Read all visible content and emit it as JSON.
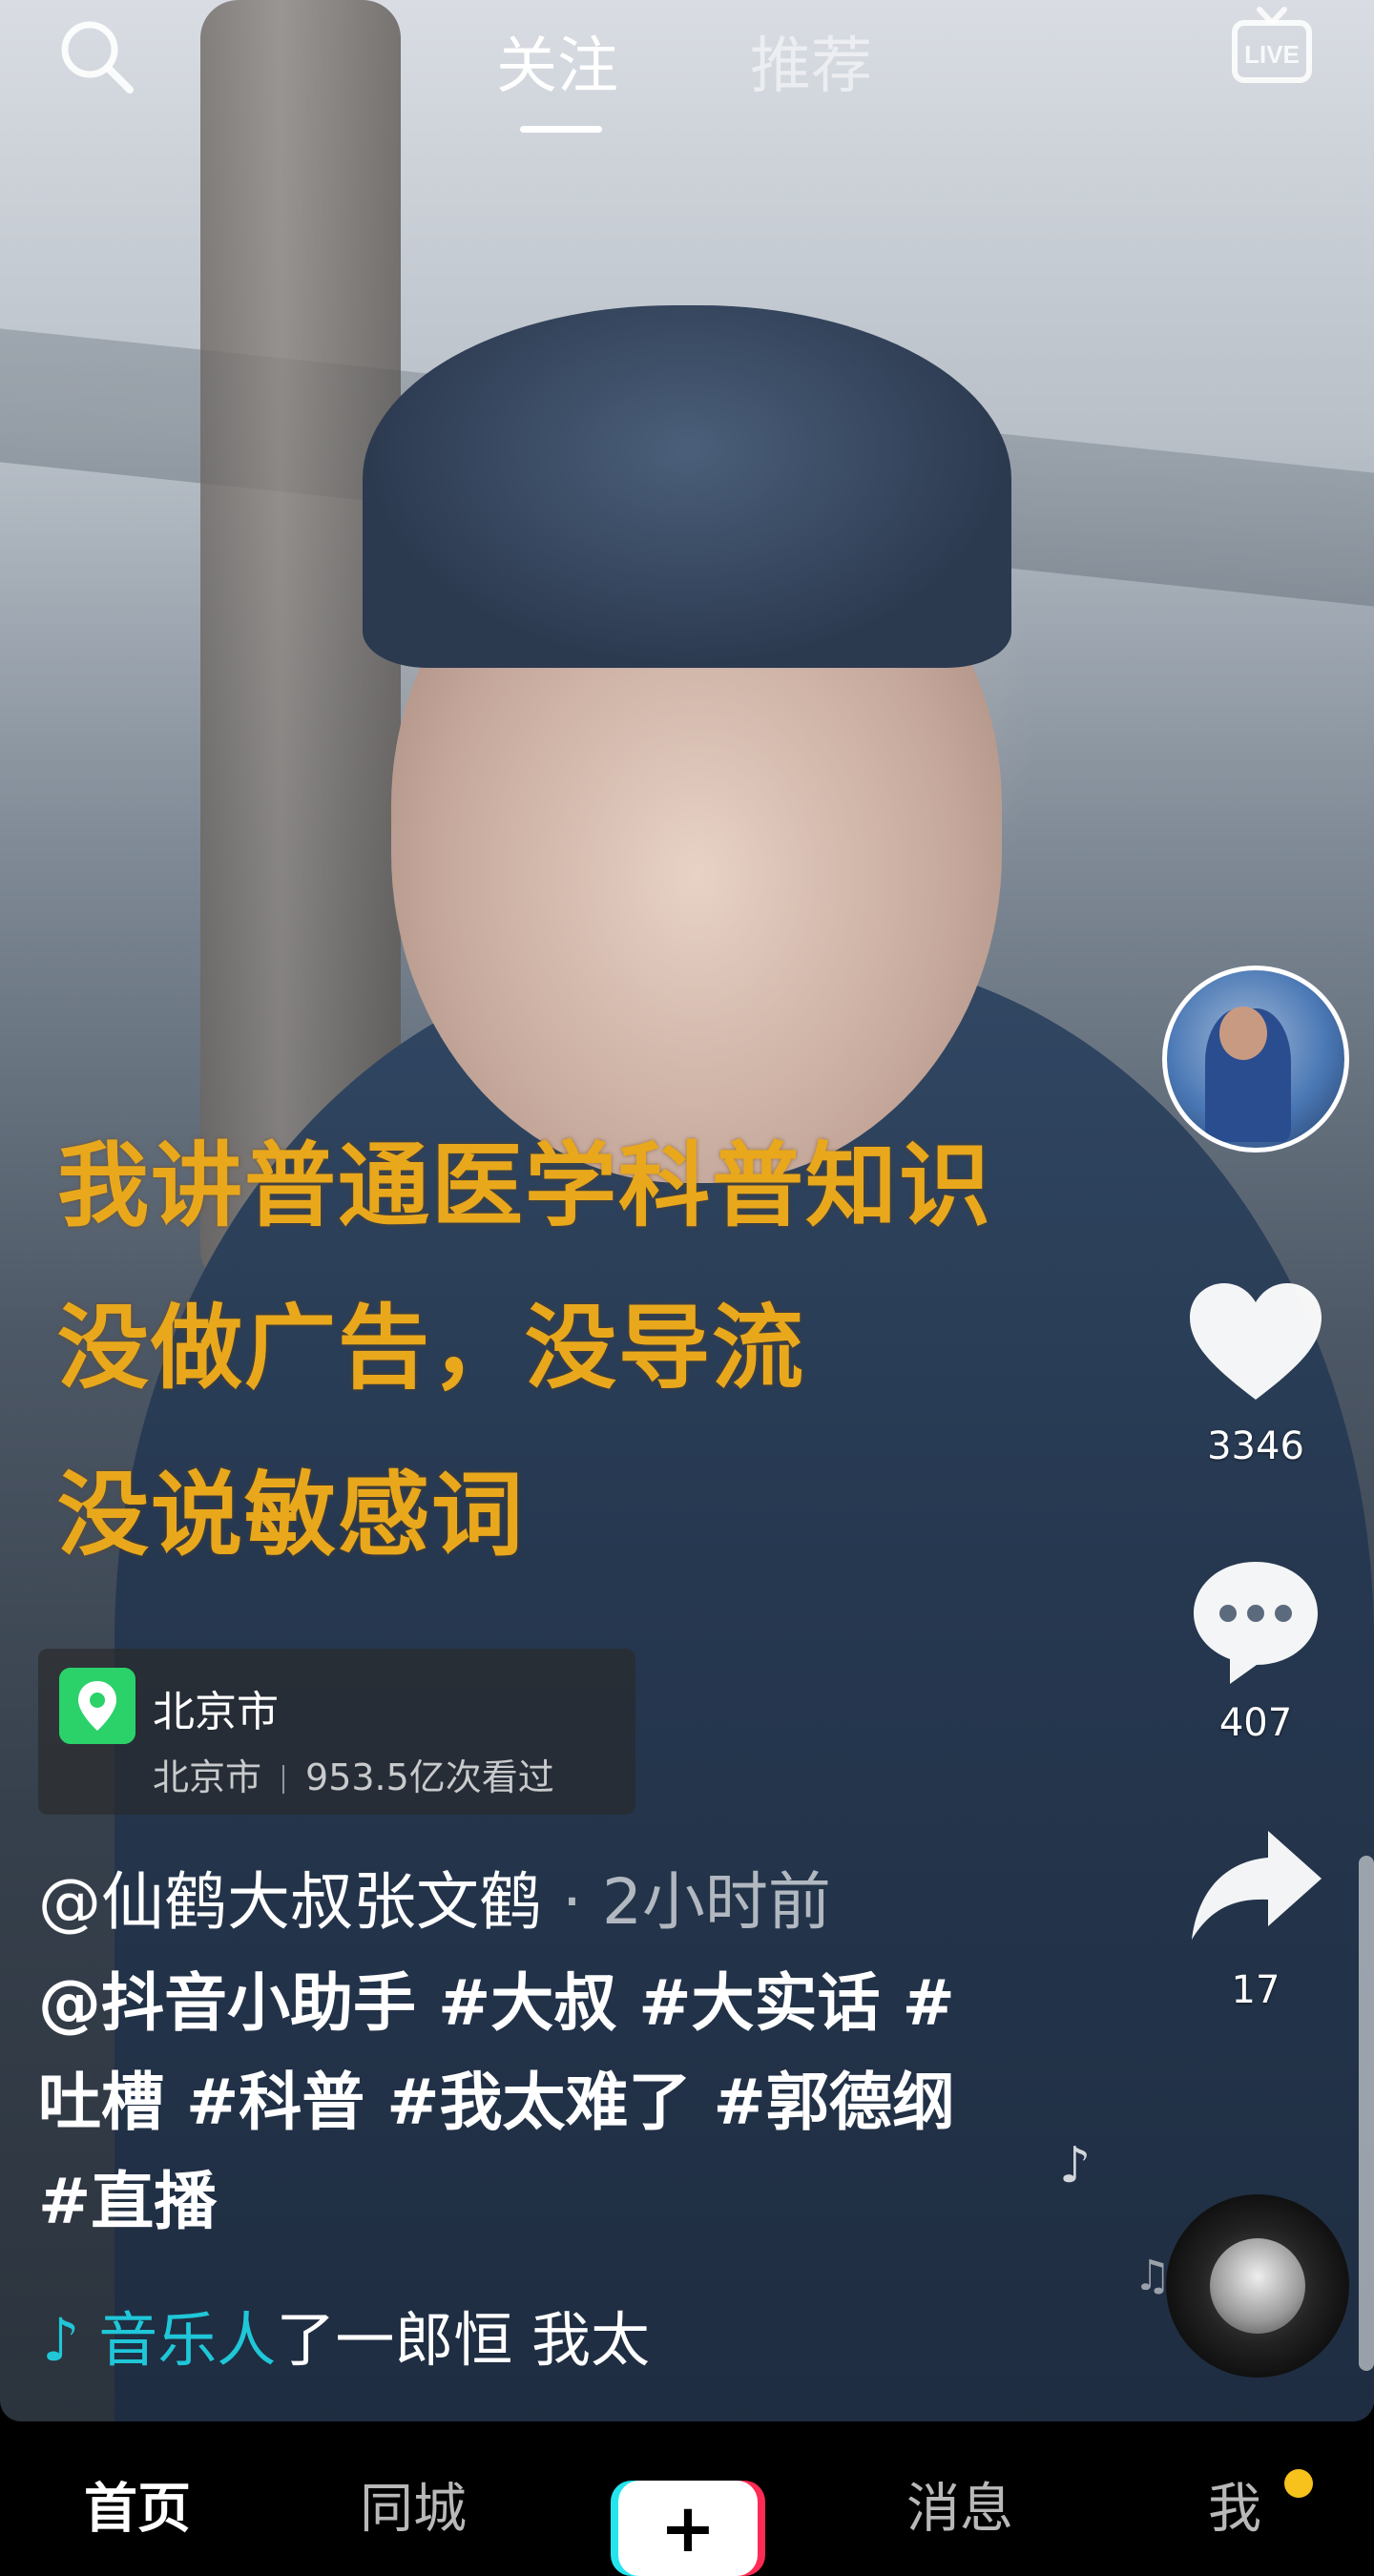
{
  "topbar": {
    "tabs": [
      {
        "label": "关注",
        "active": true
      },
      {
        "label": "推荐",
        "active": false
      }
    ],
    "live_label": "LIVE"
  },
  "video_overlay_text": [
    "我讲普通医学科普知识",
    "没做广告，没导流",
    "没说敏感词"
  ],
  "actions": {
    "likes": "3346",
    "comments": "407",
    "shares": "17"
  },
  "location": {
    "name": "北京市",
    "sub_city": "北京市",
    "views": "953.5亿次看过"
  },
  "post": {
    "author": "@仙鹤大叔张文鹤",
    "time": " · 2小时前",
    "caption": "@抖音小助手 #大叔 #大实话 #吐槽 #科普 #我太难了 #郭德纲 #直播"
  },
  "music": {
    "artist": "音乐人",
    "title": "了一郎恒    我太"
  },
  "bottom_nav": {
    "home": "首页",
    "city": "同城",
    "add": "+",
    "messages": "消息",
    "me": "我"
  },
  "colors": {
    "accent_cyan": "#1fc7d8",
    "accent_red": "#fe2c55",
    "overlay_text": "#e9a81c",
    "location_green": "#2bd26a",
    "notify_dot": "#f6c21b"
  }
}
